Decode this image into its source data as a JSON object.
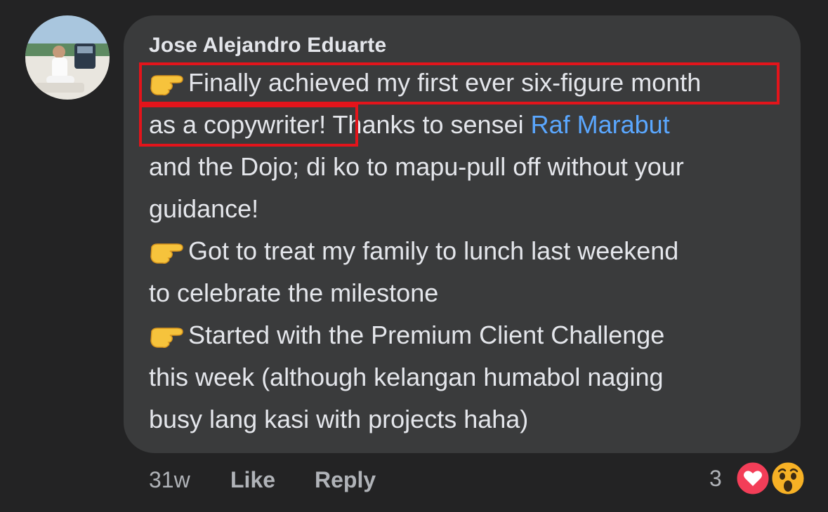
{
  "comment": {
    "author": "Jose Alejandro Eduarte",
    "lines": [
      {
        "pre": "Finally achieved my first ever six-figure month",
        "emoji": "backhand-index-pointing-right"
      },
      {
        "pre": "as a copywriter!",
        "post": " Thanks to sensei ",
        "mention": "Raf Marabut"
      },
      {
        "pre": "and the Dojo; di ko to mapu-pull off without your"
      },
      {
        "pre": "guidance!"
      },
      {
        "pre": "Got to treat my family to lunch last weekend",
        "emoji": "backhand-index-pointing-right"
      },
      {
        "pre": "to celebrate the milestone"
      },
      {
        "pre": "Started with the Premium Client Challenge",
        "emoji": "backhand-index-pointing-right"
      },
      {
        "pre": "this week (although kelangan humabol naging"
      },
      {
        "pre": "busy lang kasi with projects haha)"
      }
    ]
  },
  "footer": {
    "time": "31w",
    "like_label": "Like",
    "reply_label": "Reply",
    "reaction_count": "3",
    "reactions": [
      "heart-icon",
      "wow-icon"
    ]
  },
  "colors": {
    "background": "#232324",
    "bubble": "#3a3b3c",
    "text": "#e4e6eb",
    "muted": "#b0b3b8",
    "mention": "#5aa7ff",
    "highlight": "#e3141b",
    "heart": "#f33e58",
    "wow": "#f7b125"
  }
}
